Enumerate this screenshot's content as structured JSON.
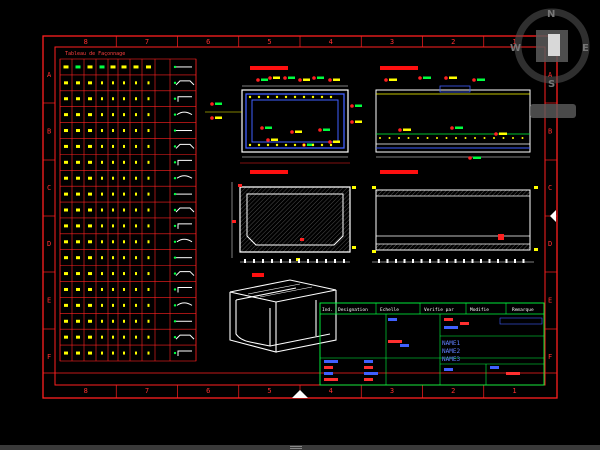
{
  "navcube": {
    "north": "N",
    "south": "S",
    "east": "E",
    "west": "W"
  },
  "rebar_table": {
    "title": "Tableau de Façonnage",
    "rows": 19
  },
  "zone_numbers": {
    "top": [
      "8",
      "7",
      "6",
      "5",
      "4",
      "3",
      "2",
      "1"
    ],
    "bottom": [
      "8",
      "7",
      "6",
      "5",
      "4",
      "3",
      "2",
      "1"
    ],
    "left": [
      "A",
      "B",
      "C",
      "D",
      "E",
      "F"
    ],
    "right": [
      "A",
      "B",
      "C",
      "D",
      "E",
      "F"
    ]
  },
  "title_block": {
    "headers": [
      "Ind.",
      "Designation",
      "Echelle",
      "Verifie par",
      "Modifie",
      "Remarque"
    ],
    "name1": "NAME1",
    "name2": "NAME2",
    "name3": "NAME3"
  }
}
